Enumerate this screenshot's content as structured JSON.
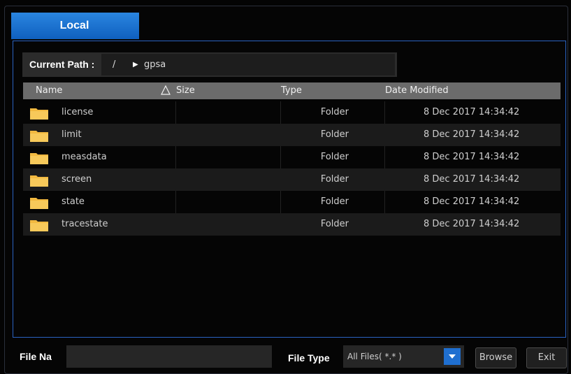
{
  "tabs": [
    {
      "label": "Local"
    }
  ],
  "path": {
    "label": "Current Path :",
    "root": "/",
    "current_dir": "gpsa"
  },
  "table": {
    "columns": {
      "name": "Name",
      "size": "Size",
      "type": "Type",
      "date": "Date Modified"
    },
    "rows": [
      {
        "name": "license",
        "size": "",
        "type": "Folder",
        "date": "8 Dec 2017 14:34:42"
      },
      {
        "name": "limit",
        "size": "",
        "type": "Folder",
        "date": "8 Dec 2017 14:34:42"
      },
      {
        "name": "measdata",
        "size": "",
        "type": "Folder",
        "date": "8 Dec 2017 14:34:42"
      },
      {
        "name": "screen",
        "size": "",
        "type": "Folder",
        "date": "8 Dec 2017 14:34:42"
      },
      {
        "name": "state",
        "size": "",
        "type": "Folder",
        "date": "8 Dec 2017 14:34:42"
      },
      {
        "name": "tracestate",
        "size": "",
        "type": "Folder",
        "date": "8 Dec 2017 14:34:42"
      }
    ]
  },
  "bottom": {
    "file_name_label": "File Na",
    "file_name_value": "",
    "file_type_label": "File Type",
    "file_type_value": "All Files( *.* )",
    "browse_label": "Browse",
    "exit_label": "Exit"
  },
  "icons": {
    "folder": "folder-icon",
    "sort": "sort-ascending-icon",
    "path_arrow": "triangle-right-icon",
    "dropdown": "chevron-down-icon"
  },
  "colors": {
    "accent": "#1f6fd0",
    "folder": "#f2b940",
    "header": "#6b6b6b",
    "background": "#040404"
  }
}
